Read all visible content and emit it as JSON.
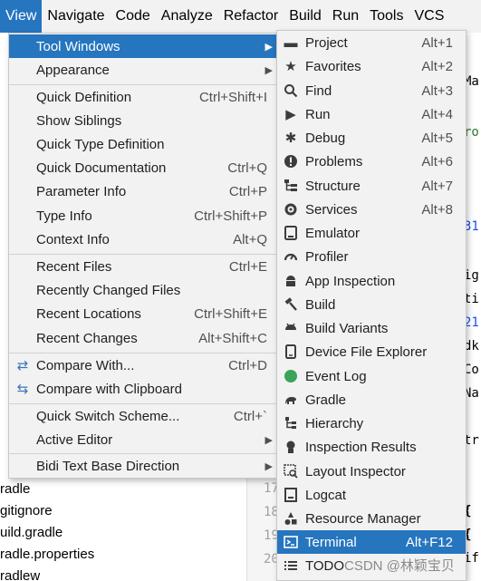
{
  "menubar": {
    "items": [
      {
        "label": "View"
      },
      {
        "label": "Navigate"
      },
      {
        "label": "Code"
      },
      {
        "label": "Analyze"
      },
      {
        "label": "Refactor"
      },
      {
        "label": "Build"
      },
      {
        "label": "Run"
      },
      {
        "label": "Tools"
      },
      {
        "label": "VCS"
      }
    ]
  },
  "project_tree": {
    "rows": [
      "radle",
      "gitignore",
      "uild.gradle",
      "radle.properties",
      "radlew"
    ]
  },
  "gutter": {
    "lines": [
      "17",
      "18",
      "19",
      "20"
    ]
  },
  "editor": {
    "snippets": [
      "Ma",
      "ro",
      "31",
      "ig",
      "ti",
      "21",
      "dk",
      "Co",
      "Na",
      "tr",
      "{",
      "{",
      "if"
    ]
  },
  "view_menu": {
    "items": [
      {
        "label": "Tool Windows",
        "shortcut": "",
        "submenu": true
      },
      {
        "label": "Appearance",
        "shortcut": "",
        "submenu": true
      },
      {
        "label": "Quick Definition",
        "shortcut": "Ctrl+Shift+I"
      },
      {
        "label": "Show Siblings",
        "shortcut": ""
      },
      {
        "label": "Quick Type Definition",
        "shortcut": ""
      },
      {
        "label": "Quick Documentation",
        "shortcut": "Ctrl+Q"
      },
      {
        "label": "Parameter Info",
        "shortcut": "Ctrl+P"
      },
      {
        "label": "Type Info",
        "shortcut": "Ctrl+Shift+P"
      },
      {
        "label": "Context Info",
        "shortcut": "Alt+Q"
      },
      {
        "label": "Recent Files",
        "shortcut": "Ctrl+E"
      },
      {
        "label": "Recently Changed Files",
        "shortcut": ""
      },
      {
        "label": "Recent Locations",
        "shortcut": "Ctrl+Shift+E"
      },
      {
        "label": "Recent Changes",
        "shortcut": "Alt+Shift+C"
      },
      {
        "label": "Compare With...",
        "shortcut": "Ctrl+D"
      },
      {
        "label": "Compare with Clipboard",
        "shortcut": ""
      },
      {
        "label": "Quick Switch Scheme...",
        "shortcut": "Ctrl+`"
      },
      {
        "label": "Active Editor",
        "shortcut": "",
        "submenu": true
      },
      {
        "label": "Bidi Text Base Direction",
        "shortcut": "",
        "submenu": true
      }
    ]
  },
  "tool_windows_menu": {
    "items": [
      {
        "label": "Project",
        "shortcut": "Alt+1",
        "icon": "folder-icon"
      },
      {
        "label": "Favorites",
        "shortcut": "Alt+2",
        "icon": "star-icon"
      },
      {
        "label": "Find",
        "shortcut": "Alt+3",
        "icon": "search-icon"
      },
      {
        "label": "Run",
        "shortcut": "Alt+4",
        "icon": "play-icon"
      },
      {
        "label": "Debug",
        "shortcut": "Alt+5",
        "icon": "bug-icon"
      },
      {
        "label": "Problems",
        "shortcut": "Alt+6",
        "icon": "alert-icon"
      },
      {
        "label": "Structure",
        "shortcut": "Alt+7",
        "icon": "structure-icon"
      },
      {
        "label": "Services",
        "shortcut": "Alt+8",
        "icon": "services-icon"
      },
      {
        "label": "Emulator",
        "shortcut": "",
        "icon": "emulator-icon"
      },
      {
        "label": "Profiler",
        "shortcut": "",
        "icon": "gauge-icon"
      },
      {
        "label": "App Inspection",
        "shortcut": "",
        "icon": "android-icon"
      },
      {
        "label": "Build",
        "shortcut": "",
        "icon": "hammer-icon"
      },
      {
        "label": "Build Variants",
        "shortcut": "",
        "icon": "android-icon"
      },
      {
        "label": "Device File Explorer",
        "shortcut": "",
        "icon": "device-icon"
      },
      {
        "label": "Event Log",
        "shortcut": "",
        "icon": "event-log-icon"
      },
      {
        "label": "Gradle",
        "shortcut": "",
        "icon": "gradle-icon"
      },
      {
        "label": "Hierarchy",
        "shortcut": "",
        "icon": "hierarchy-icon"
      },
      {
        "label": "Inspection Results",
        "shortcut": "",
        "icon": "inspection-icon"
      },
      {
        "label": "Layout Inspector",
        "shortcut": "",
        "icon": "layout-inspector-icon"
      },
      {
        "label": "Logcat",
        "shortcut": "",
        "icon": "logcat-icon"
      },
      {
        "label": "Resource Manager",
        "shortcut": "",
        "icon": "resource-manager-icon"
      },
      {
        "label": "Terminal",
        "shortcut": "Alt+F12",
        "icon": "terminal-icon"
      },
      {
        "label": "TODO",
        "shortcut": "",
        "icon": "todo-icon"
      }
    ]
  },
  "watermark": "CSDN @林颖宝贝",
  "colors": {
    "selection": "#2675bf",
    "menu_bg": "#f2f2f2",
    "event_log_green": "#3ca35a"
  }
}
